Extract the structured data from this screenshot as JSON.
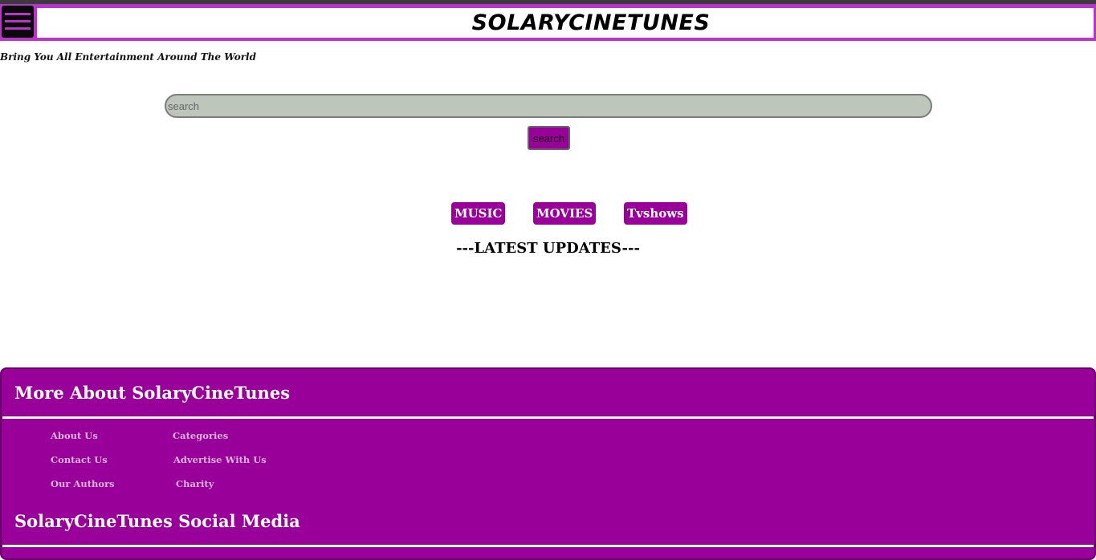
{
  "header": {
    "logo_text": "SOLARYCINETUNES",
    "menu_icon": "hamburger-icon",
    "accent_color": "#bb33cc"
  },
  "tagline": "Bring You All Entertainment Around The World",
  "search": {
    "placeholder": "search",
    "value": "",
    "button_label": "search"
  },
  "categories": [
    {
      "label": "MUSIC"
    },
    {
      "label": "MOVIES"
    },
    {
      "label": "Tvshows"
    }
  ],
  "latest_heading": "---LATEST UPDATES---",
  "footer": {
    "background_color": "#990099",
    "about_heading": "More About SolaryCineTunes",
    "links": [
      {
        "label": "About Us"
      },
      {
        "label": "Categories"
      },
      {
        "label": "Contact Us"
      },
      {
        "label": "Advertise With Us"
      },
      {
        "label": "Our Authors"
      },
      {
        "label": "Charity"
      }
    ],
    "social_heading": "SolaryCineTunes Social Media"
  }
}
